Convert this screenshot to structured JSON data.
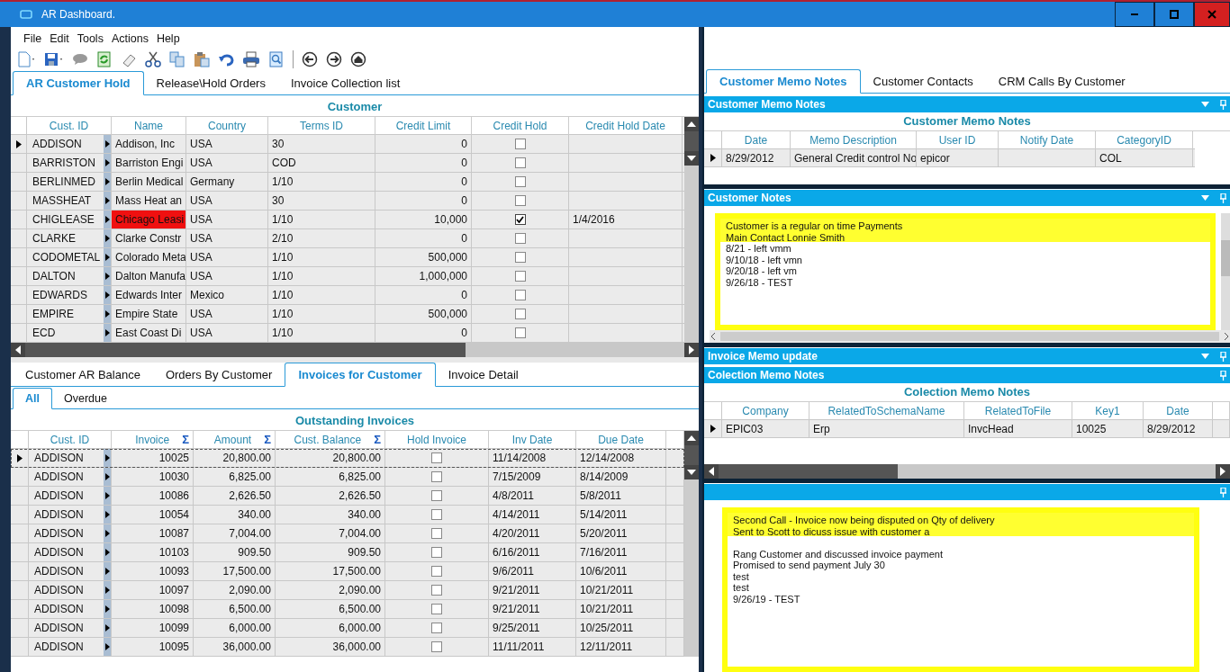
{
  "window": {
    "title": "AR Dashboard."
  },
  "menu": [
    "File",
    "Edit",
    "Tools",
    "Actions",
    "Help"
  ],
  "main_tabs": [
    {
      "label": "AR Customer Hold",
      "selected": true
    },
    {
      "label": "Release\\Hold Orders",
      "selected": false
    },
    {
      "label": "Invoice Collection list",
      "selected": false
    }
  ],
  "customer_grid": {
    "title": "Customer",
    "columns": [
      {
        "label": "Cust. ID",
        "kind": "link"
      },
      {
        "label": "Name",
        "kind": "name"
      },
      {
        "label": "Country",
        "kind": "text"
      },
      {
        "label": "Terms ID",
        "kind": "text"
      },
      {
        "label": "Credit Limit",
        "kind": "num"
      },
      {
        "label": "Credit Hold",
        "kind": "check"
      },
      {
        "label": "Credit Hold Date",
        "kind": "text"
      }
    ],
    "rows": [
      {
        "cells": [
          "ADDISON",
          "Addison, Inc",
          "USA",
          "30",
          "0",
          "",
          ""
        ],
        "checked": false,
        "selected": true,
        "flagged": false
      },
      {
        "cells": [
          "BARRISTON",
          "Barriston Engi",
          "USA",
          "COD",
          "0",
          "",
          ""
        ],
        "checked": false,
        "selected": false,
        "flagged": false
      },
      {
        "cells": [
          "BERLINMED",
          "Berlin Medical",
          "Germany",
          "1/10",
          "0",
          "",
          ""
        ],
        "checked": false,
        "selected": false,
        "flagged": false
      },
      {
        "cells": [
          "MASSHEAT",
          "Mass Heat an",
          "USA",
          "30",
          "0",
          "",
          ""
        ],
        "checked": false,
        "selected": false,
        "flagged": false
      },
      {
        "cells": [
          "CHIGLEASE",
          "Chicago Leasi",
          "USA",
          "1/10",
          "10,000",
          "",
          "1/4/2016"
        ],
        "checked": true,
        "selected": false,
        "flagged": true
      },
      {
        "cells": [
          "CLARKE",
          "Clarke Constr",
          "USA",
          "2/10",
          "0",
          "",
          ""
        ],
        "checked": false,
        "selected": false,
        "flagged": false
      },
      {
        "cells": [
          "CODOMETAL",
          "Colorado Meta",
          "USA",
          "1/10",
          "500,000",
          "",
          ""
        ],
        "checked": false,
        "selected": false,
        "flagged": false
      },
      {
        "cells": [
          "DALTON",
          "Dalton Manufa",
          "USA",
          "1/10",
          "1,000,000",
          "",
          ""
        ],
        "checked": false,
        "selected": false,
        "flagged": false
      },
      {
        "cells": [
          "EDWARDS",
          "Edwards Inter",
          "Mexico",
          "1/10",
          "0",
          "",
          ""
        ],
        "checked": false,
        "selected": false,
        "flagged": false
      },
      {
        "cells": [
          "EMPIRE",
          "Empire State",
          "USA",
          "1/10",
          "500,000",
          "",
          ""
        ],
        "checked": false,
        "selected": false,
        "flagged": false
      },
      {
        "cells": [
          "ECD",
          "East Coast Di",
          "USA",
          "1/10",
          "0",
          "",
          ""
        ],
        "checked": false,
        "selected": false,
        "flagged": false
      }
    ]
  },
  "lower_tabs": [
    {
      "label": "Customer AR Balance",
      "selected": false
    },
    {
      "label": "Orders By Customer",
      "selected": false
    },
    {
      "label": "Invoices for Customer",
      "selected": true
    },
    {
      "label": "Invoice Detail",
      "selected": false
    }
  ],
  "sub_tabs": [
    {
      "label": "All",
      "selected": true
    },
    {
      "label": "Overdue",
      "selected": false
    }
  ],
  "invoice_grid": {
    "title": "Outstanding Invoices",
    "columns": [
      {
        "label": "Cust. ID",
        "kind": "link"
      },
      {
        "label": "Invoice",
        "kind": "num",
        "sum_mark": "Σ"
      },
      {
        "label": "Amount",
        "kind": "num",
        "sum_mark": "Σ"
      },
      {
        "label": "Cust. Balance",
        "kind": "num",
        "sum_mark": "Σ"
      },
      {
        "label": "Hold Invoice",
        "kind": "check"
      },
      {
        "label": "Inv Date",
        "kind": "text"
      },
      {
        "label": "Due Date",
        "kind": "text"
      }
    ],
    "rows": [
      {
        "cells": [
          "ADDISON",
          "10025",
          "20,800.00",
          "20,800.00",
          "",
          "11/14/2008",
          "12/14/2008"
        ],
        "checked": false,
        "selected": true
      },
      {
        "cells": [
          "ADDISON",
          "10030",
          "6,825.00",
          "6,825.00",
          "",
          "7/15/2009",
          "8/14/2009"
        ],
        "checked": false,
        "selected": false
      },
      {
        "cells": [
          "ADDISON",
          "10086",
          "2,626.50",
          "2,626.50",
          "",
          "4/8/2011",
          "5/8/2011"
        ],
        "checked": false,
        "selected": false
      },
      {
        "cells": [
          "ADDISON",
          "10054",
          "340.00",
          "340.00",
          "",
          "4/14/2011",
          "5/14/2011"
        ],
        "checked": false,
        "selected": false
      },
      {
        "cells": [
          "ADDISON",
          "10087",
          "7,004.00",
          "7,004.00",
          "",
          "4/20/2011",
          "5/20/2011"
        ],
        "checked": false,
        "selected": false
      },
      {
        "cells": [
          "ADDISON",
          "10103",
          "909.50",
          "909.50",
          "",
          "6/16/2011",
          "7/16/2011"
        ],
        "checked": false,
        "selected": false
      },
      {
        "cells": [
          "ADDISON",
          "10093",
          "17,500.00",
          "17,500.00",
          "",
          "9/6/2011",
          "10/6/2011"
        ],
        "checked": false,
        "selected": false
      },
      {
        "cells": [
          "ADDISON",
          "10097",
          "2,090.00",
          "2,090.00",
          "",
          "9/21/2011",
          "10/21/2011"
        ],
        "checked": false,
        "selected": false
      },
      {
        "cells": [
          "ADDISON",
          "10098",
          "6,500.00",
          "6,500.00",
          "",
          "9/21/2011",
          "10/21/2011"
        ],
        "checked": false,
        "selected": false
      },
      {
        "cells": [
          "ADDISON",
          "10099",
          "6,000.00",
          "6,000.00",
          "",
          "9/25/2011",
          "10/25/2011"
        ],
        "checked": false,
        "selected": false
      },
      {
        "cells": [
          "ADDISON",
          "10095",
          "36,000.00",
          "36,000.00",
          "",
          "11/11/2011",
          "12/11/2011"
        ],
        "checked": false,
        "selected": false
      }
    ]
  },
  "right_tabs": [
    {
      "label": "Customer Memo Notes",
      "selected": true
    },
    {
      "label": "Customer Contacts",
      "selected": false
    },
    {
      "label": "CRM Calls By Customer",
      "selected": false
    }
  ],
  "memo_panel": {
    "header": "Customer Memo Notes",
    "grid": {
      "title": "Customer Memo Notes",
      "columns": [
        {
          "label": "Date"
        },
        {
          "label": "Memo Description"
        },
        {
          "label": "User ID"
        },
        {
          "label": "Notify Date"
        },
        {
          "label": "CategoryID"
        }
      ],
      "rows": [
        {
          "cells": [
            "8/29/2012",
            "General Credit control No",
            "epicor",
            "",
            "COL"
          ],
          "selected": true
        }
      ]
    }
  },
  "customer_notes": {
    "header": "Customer Notes",
    "text": "Customer is a regular on time Payments\nMain Contact Lonnie Smith\n8/21 - left vmm\n9/10/18 - left vmn\n9/20/18 - left vm\n9/26/18 - TEST",
    "highlighted": true
  },
  "invoice_memo": {
    "header": "Invoice Memo update"
  },
  "collection_panel": {
    "header": "Colection Memo Notes",
    "grid": {
      "title": "Colection Memo Notes",
      "columns": [
        {
          "label": "Company"
        },
        {
          "label": "RelatedToSchemaName"
        },
        {
          "label": "RelatedToFile"
        },
        {
          "label": "Key1"
        },
        {
          "label": "Date"
        }
      ],
      "rows": [
        {
          "cells": [
            "EPIC03",
            "Erp",
            "InvcHead",
            "10025",
            "8/29/2012"
          ],
          "selected": true
        }
      ]
    }
  },
  "collection_notes": {
    "text": "Second Call - Invoice now being disputed on Qty of delivery\nSent to Scott to dicuss issue with customer a\n\nRang Customer and discussed invoice payment\nPromised to send payment July 30\ntest\ntest\n9/26/19 - TEST",
    "highlighted": true
  }
}
